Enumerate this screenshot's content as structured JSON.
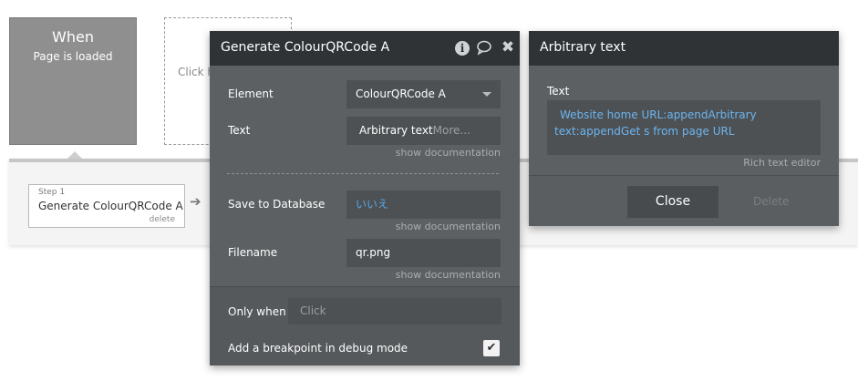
{
  "canvas": {
    "when_card": {
      "title": "When",
      "subtitle": "Page is loaded"
    },
    "placeholder_card": {
      "text": "Click h"
    },
    "step": {
      "number": "Step 1",
      "name": "Generate ColourQRCode A",
      "delete": "delete"
    },
    "arrow_glyph": "➔"
  },
  "panel": {
    "title": "Generate ColourQRCode A",
    "icons": [
      "info-icon",
      "comment-icon",
      "close-icon"
    ],
    "element": {
      "label": "Element",
      "value": "ColourQRCode A"
    },
    "text": {
      "label": "Text",
      "value": "Arbitrary text",
      "more": "More...",
      "doc": "show documentation"
    },
    "save_to_db": {
      "label": "Save to Database",
      "value": "いいえ",
      "doc": "show documentation"
    },
    "filename": {
      "label": "Filename",
      "value": "qr.png",
      "doc": "show documentation"
    },
    "only_when": {
      "label": "Only when",
      "placeholder": "Click"
    },
    "breakpoint": {
      "label": "Add a breakpoint in debug mode",
      "checked": true
    }
  },
  "panel2": {
    "title": "Arbitrary text",
    "text_label": "Text",
    "text_line1": "Website home URL:appendArbitrary",
    "text_line2": "text:appendGet s from page URL",
    "rich": "Rich text editor",
    "close": "Close",
    "delete": "Delete"
  },
  "colors": {
    "panel_bg": "#5c6063",
    "header_bg": "#2f3336",
    "link_blue": "#6cb5ef"
  }
}
